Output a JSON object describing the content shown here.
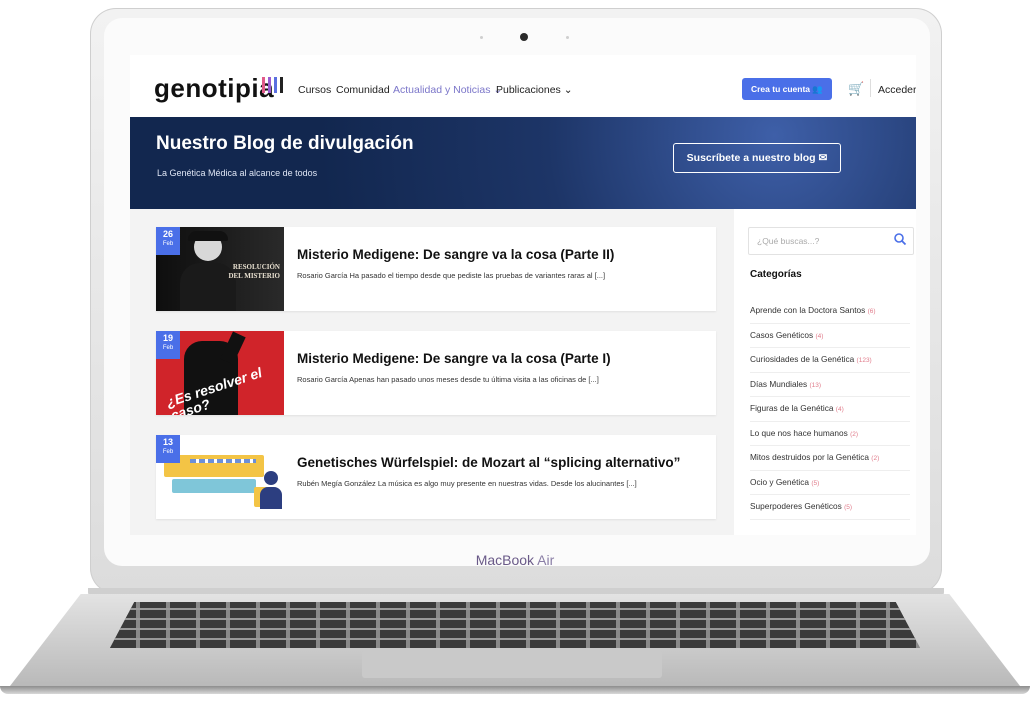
{
  "device": {
    "brand": "MacBook",
    "model": "Air"
  },
  "site": {
    "logo": "genotipia",
    "logo_bar_colors": [
      "#e05a8a",
      "#9b5bd1",
      "#5a6fe0",
      "#222222"
    ],
    "nav": {
      "items": [
        "Cursos",
        "Comunidad",
        "Actualidad y Noticias",
        "Publicaciones"
      ],
      "active_index": 2,
      "cta_label": "Crea tu cuenta",
      "login_label": "Acceder"
    },
    "hero": {
      "title": "Nuestro Blog de divulgación",
      "subtitle": "La Genética Médica al alcance de todos",
      "subscribe_label": "Suscríbete a nuestro blog"
    },
    "posts": [
      {
        "day": "26",
        "month": "Feb",
        "image_text": "RESOLUCIÓN DEL MISTERIO",
        "title": "Misterio Medigene: De sangre va la cosa (Parte II)",
        "excerpt": "Rosario García Ha pasado el tiempo desde que pediste las pruebas de variantes raras al [...]"
      },
      {
        "day": "19",
        "month": "Feb",
        "image_text": "¿Es resolver el caso?",
        "title": "Misterio Medigene: De sangre va la cosa (Parte I)",
        "excerpt": "Rosario García Apenas han pasado unos meses desde tu última visita a las oficinas de [...]"
      },
      {
        "day": "13",
        "month": "Feb",
        "image_text": "",
        "title": "Genetisches Würfelspiel: de Mozart al “splicing alternativo”",
        "excerpt": "Rubén Megía González La música es algo muy presente en nuestras vidas. Desde los alucinantes [...]"
      }
    ],
    "sidebar": {
      "search_placeholder": "¿Qué buscas...?",
      "categories_title": "Categorías",
      "categories": [
        {
          "name": "Aprende con la Doctora Santos",
          "count": "(6)"
        },
        {
          "name": "Casos Genéticos",
          "count": "(4)"
        },
        {
          "name": "Curiosidades de la Genética",
          "count": "(123)"
        },
        {
          "name": "Días Mundiales",
          "count": "(13)"
        },
        {
          "name": "Figuras de la Genética",
          "count": "(4)"
        },
        {
          "name": "Lo que nos hace humanos",
          "count": "(2)"
        },
        {
          "name": "Mitos destruidos por la Genética",
          "count": "(2)"
        },
        {
          "name": "Ocio y Genética",
          "count": "(5)"
        },
        {
          "name": "Superpoderes Genéticos",
          "count": "(5)"
        }
      ]
    },
    "colors": {
      "accent": "#4a6fe8",
      "hero_bg": "#1d3567",
      "active_nav": "#7b76c9",
      "count": "#e07b8a"
    }
  }
}
